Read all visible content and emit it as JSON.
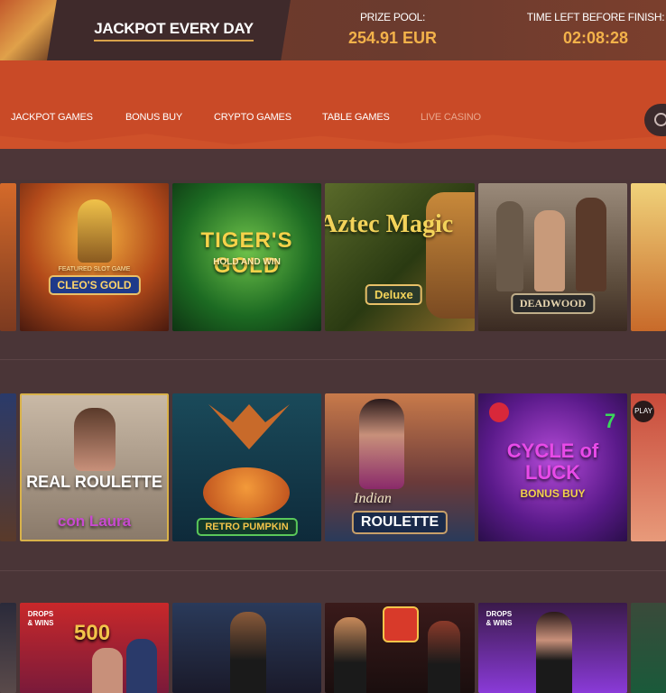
{
  "banner": {
    "title": "JACKPOT EVERY DAY",
    "prize_label": "PRIZE POOL:",
    "prize_value": "254.91 EUR",
    "time_label": "TIME LEFT BEFORE FINISH:",
    "time_value": "02:08:28"
  },
  "nav": {
    "items": [
      {
        "label": "JACKPOT GAMES"
      },
      {
        "label": "BONUS BUY"
      },
      {
        "label": "CRYPTO GAMES"
      },
      {
        "label": "TABLE GAMES"
      },
      {
        "label": "LIVE CASINO"
      }
    ]
  },
  "games": {
    "row1": [
      {
        "title": "CLEO'S GOLD",
        "tagline": "FEATURED SLOT GAME"
      },
      {
        "title": "TIGER'S GOLD",
        "sub": "HOLD AND WIN"
      },
      {
        "title": "Aztec Magic",
        "sub": "Deluxe"
      },
      {
        "title": "DEADWOOD"
      }
    ],
    "row2": [
      {
        "title": "REAL ROULETTE",
        "sub": "con Laura"
      },
      {
        "title": "RETRO PUMPKIN"
      },
      {
        "title": "ROULETTE",
        "script": "Indian"
      },
      {
        "title": "CYCLE of LUCK",
        "sub": "BONUS BUY"
      }
    ],
    "row3": [
      {
        "badge": "DROPS & WINS",
        "value": "500"
      },
      {
        "badge": "DROPS & WINS"
      }
    ],
    "play_badge": "PLAY"
  },
  "colors": {
    "nav_bg": "#c94a27",
    "page_bg": "#4a3537",
    "accent_gold": "#f3b24a"
  }
}
